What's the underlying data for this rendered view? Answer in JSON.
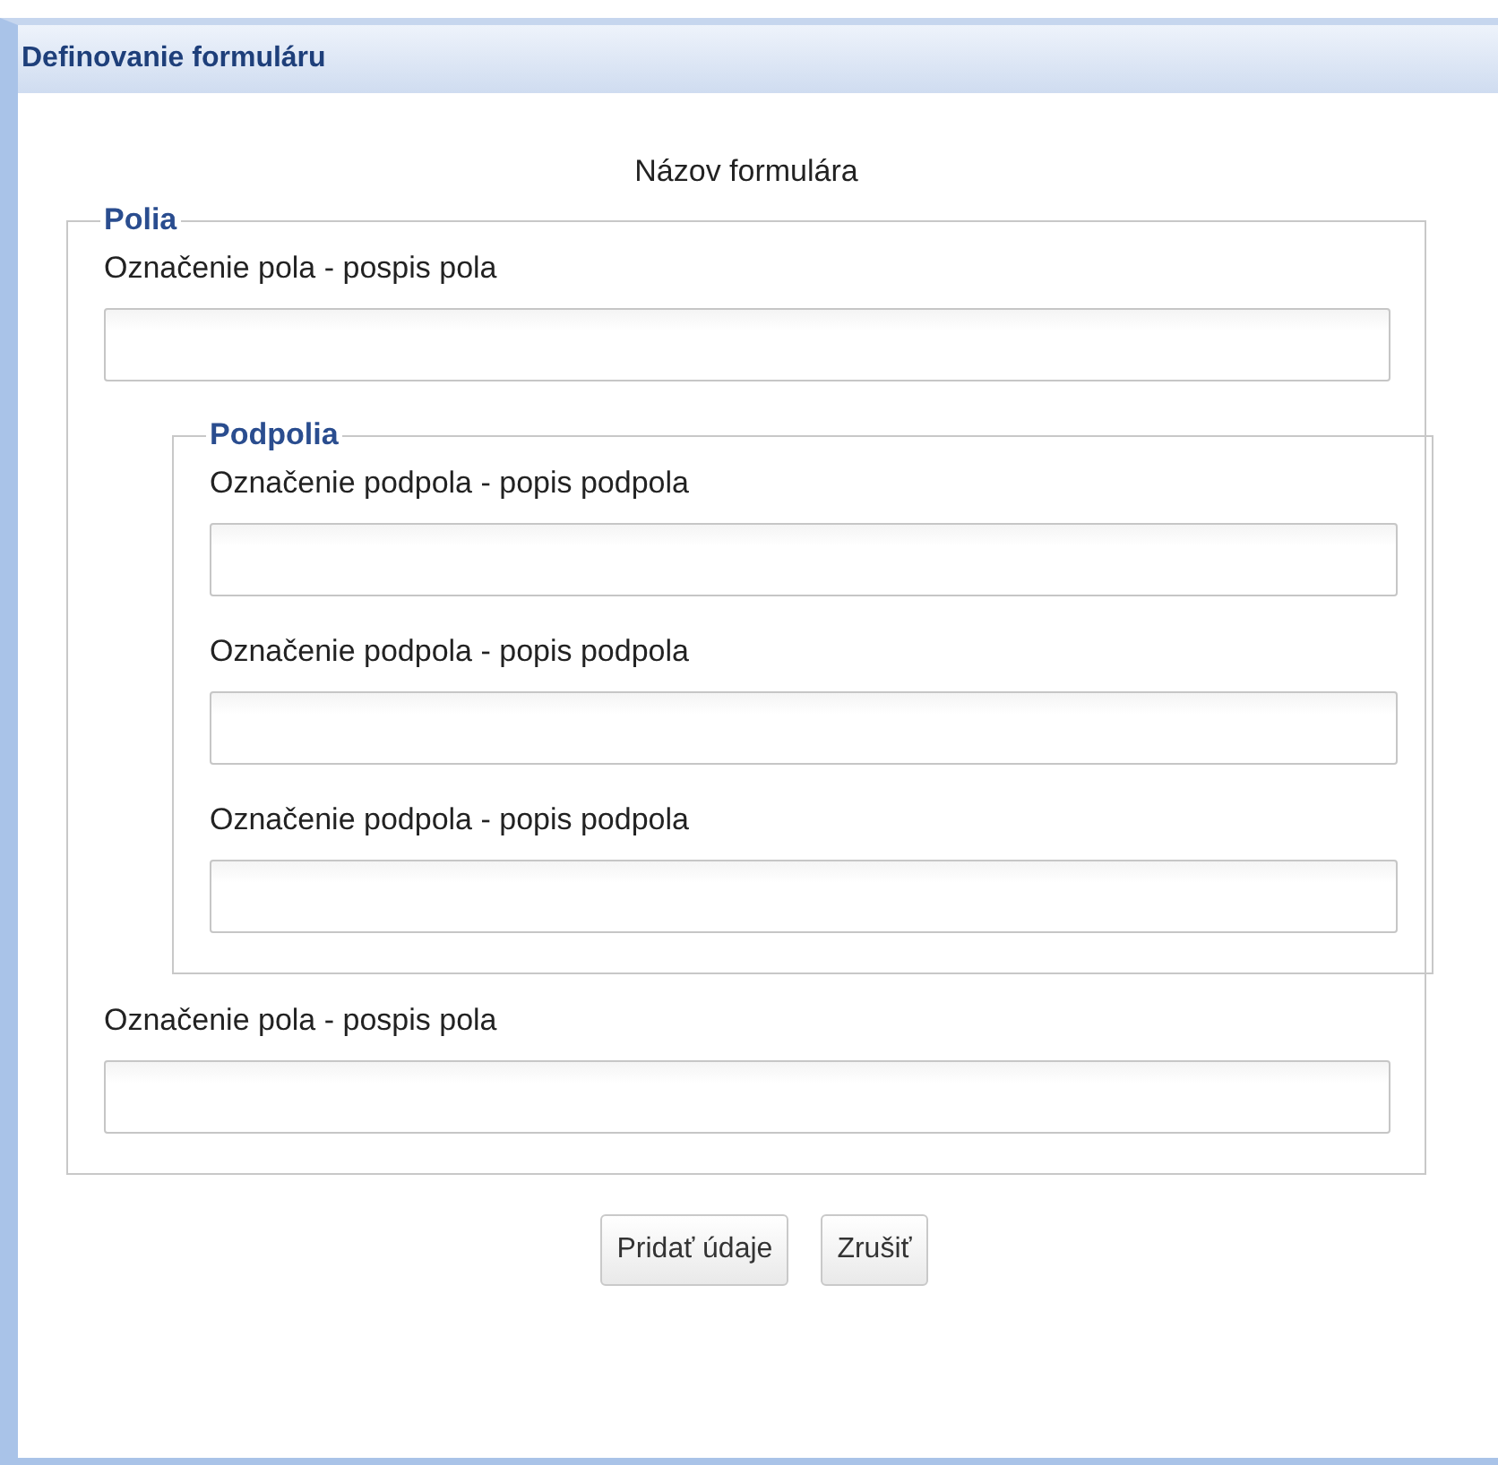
{
  "window": {
    "title": "Definovanie formuláru"
  },
  "form_name": "Názov formulára",
  "fieldset": {
    "legend": "Polia",
    "fields": [
      {
        "kind": "field",
        "label": "Označenie pola - pospis pola"
      },
      {
        "kind": "group",
        "legend": "Podpolia",
        "fields": [
          {
            "kind": "field",
            "label": "Označenie podpola - popis podpola"
          },
          {
            "kind": "field",
            "label": "Označenie podpola - popis podpola"
          },
          {
            "kind": "field",
            "label": "Označenie podpola - popis podpola"
          }
        ]
      },
      {
        "kind": "field",
        "label": "Označenie pola - pospis pola"
      }
    ]
  },
  "buttons": [
    "Pridať údaje",
    "Zrušiť"
  ]
}
